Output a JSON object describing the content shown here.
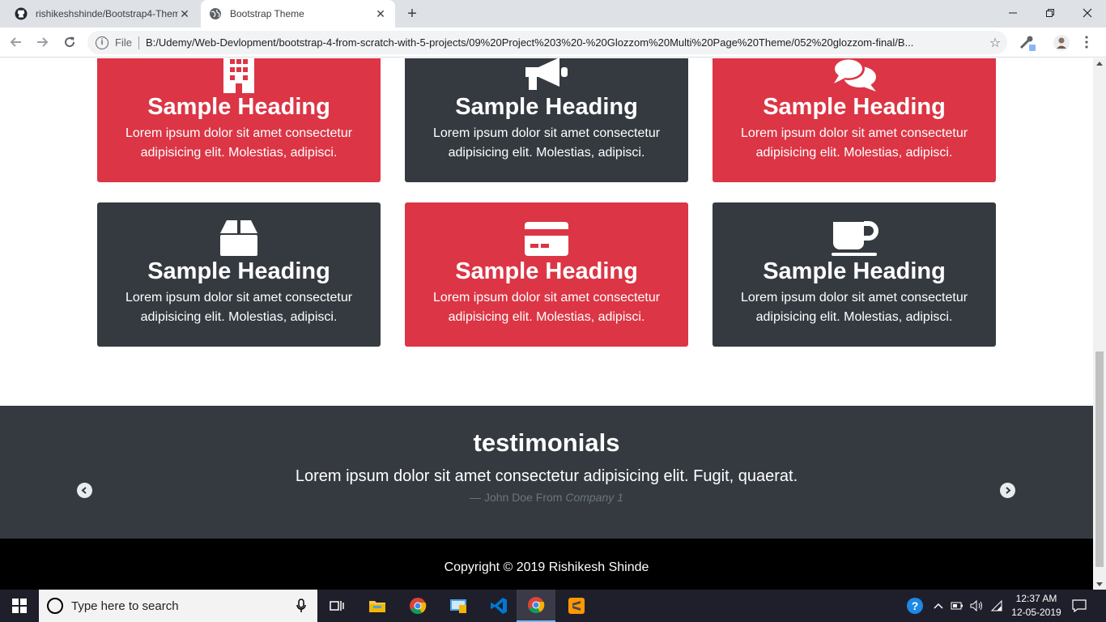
{
  "browser": {
    "tabs": [
      {
        "title": "rishikeshshinde/Bootstrap4-Them",
        "icon": "github-icon",
        "active": false
      },
      {
        "title": "Bootstrap Theme",
        "icon": "globe-icon",
        "active": true
      }
    ],
    "address": {
      "scheme": "File",
      "url": "B:/Udemy/Web-Devlopment/bootstrap-4-from-scratch-with-5-projects/09%20Project%203%20-%20Glozzom%20Multi%20Page%20Theme/052%20glozzom-final/B..."
    }
  },
  "page": {
    "cards": [
      {
        "heading": "Sample Heading",
        "text": "Lorem ipsum dolor sit amet consectetur adipisicing elit. Molestias, adipisci.",
        "icon": "building-icon",
        "color": "#dc3545"
      },
      {
        "heading": "Sample Heading",
        "text": "Lorem ipsum dolor sit amet consectetur adipisicing elit. Molestias, adipisci.",
        "icon": "bullhorn-icon",
        "color": "#343a40"
      },
      {
        "heading": "Sample Heading",
        "text": "Lorem ipsum dolor sit amet consectetur adipisicing elit. Molestias, adipisci.",
        "icon": "comments-icon",
        "color": "#dc3545"
      },
      {
        "heading": "Sample Heading",
        "text": "Lorem ipsum dolor sit amet consectetur adipisicing elit. Molestias, adipisci.",
        "icon": "box-icon",
        "color": "#343a40"
      },
      {
        "heading": "Sample Heading",
        "text": "Lorem ipsum dolor sit amet consectetur adipisicing elit. Molestias, adipisci.",
        "icon": "credit-card-icon",
        "color": "#dc3545"
      },
      {
        "heading": "Sample Heading",
        "text": "Lorem ipsum dolor sit amet consectetur adipisicing elit. Molestias, adipisci.",
        "icon": "coffee-icon",
        "color": "#343a40"
      }
    ],
    "testimonials": {
      "heading": "testimonials",
      "quote": "Lorem ipsum dolor sit amet consectetur adipisicing elit. Fugit, quaerat.",
      "author": "— John Doe From",
      "company": "Company 1"
    },
    "footer": {
      "copyright": "Copyright © 2019 Rishikesh Shinde"
    }
  },
  "taskbar": {
    "search_placeholder": "Type here to search",
    "time": "12:37 AM",
    "date": "12-05-2019",
    "apps": [
      "task-view-icon",
      "file-explorer-icon",
      "chrome-icon",
      "control-panel-icon",
      "vscode-icon",
      "chrome-icon",
      "sublime-text-icon"
    ]
  }
}
